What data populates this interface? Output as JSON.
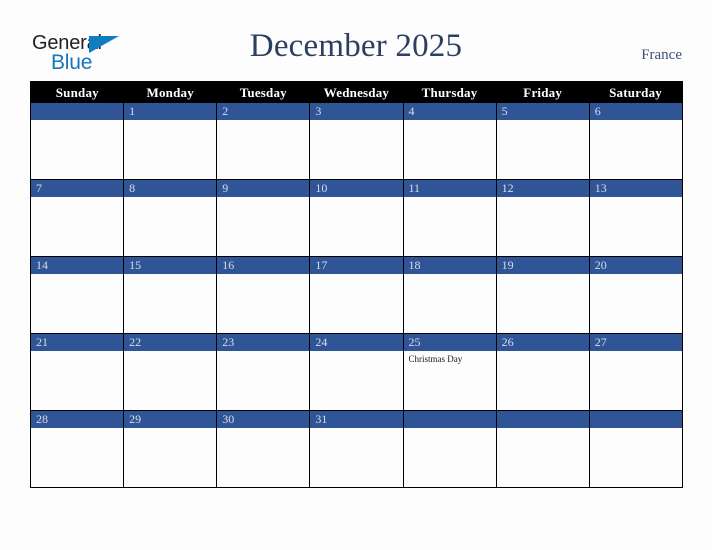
{
  "brand": {
    "name_part1": "General",
    "name_part2": "Blue",
    "triangle_color": "#0f7dc2",
    "text_color": "#231f20",
    "blue_color": "#1577bd"
  },
  "header": {
    "title": "December 2025",
    "country": "France",
    "title_color": "#2c3e63"
  },
  "calendar": {
    "accent_color": "#2f5597",
    "header_bg": "#000000",
    "weekdays": [
      "Sunday",
      "Monday",
      "Tuesday",
      "Wednesday",
      "Thursday",
      "Friday",
      "Saturday"
    ],
    "weeks": [
      [
        {
          "day": "",
          "events": []
        },
        {
          "day": "1",
          "events": []
        },
        {
          "day": "2",
          "events": []
        },
        {
          "day": "3",
          "events": []
        },
        {
          "day": "4",
          "events": []
        },
        {
          "day": "5",
          "events": []
        },
        {
          "day": "6",
          "events": []
        }
      ],
      [
        {
          "day": "7",
          "events": []
        },
        {
          "day": "8",
          "events": []
        },
        {
          "day": "9",
          "events": []
        },
        {
          "day": "10",
          "events": []
        },
        {
          "day": "11",
          "events": []
        },
        {
          "day": "12",
          "events": []
        },
        {
          "day": "13",
          "events": []
        }
      ],
      [
        {
          "day": "14",
          "events": []
        },
        {
          "day": "15",
          "events": []
        },
        {
          "day": "16",
          "events": []
        },
        {
          "day": "17",
          "events": []
        },
        {
          "day": "18",
          "events": []
        },
        {
          "day": "19",
          "events": []
        },
        {
          "day": "20",
          "events": []
        }
      ],
      [
        {
          "day": "21",
          "events": []
        },
        {
          "day": "22",
          "events": []
        },
        {
          "day": "23",
          "events": []
        },
        {
          "day": "24",
          "events": []
        },
        {
          "day": "25",
          "events": [
            "Christmas Day"
          ]
        },
        {
          "day": "26",
          "events": []
        },
        {
          "day": "27",
          "events": []
        }
      ],
      [
        {
          "day": "28",
          "events": []
        },
        {
          "day": "29",
          "events": []
        },
        {
          "day": "30",
          "events": []
        },
        {
          "day": "31",
          "events": []
        },
        {
          "day": "",
          "events": []
        },
        {
          "day": "",
          "events": []
        },
        {
          "day": "",
          "events": []
        }
      ]
    ]
  }
}
